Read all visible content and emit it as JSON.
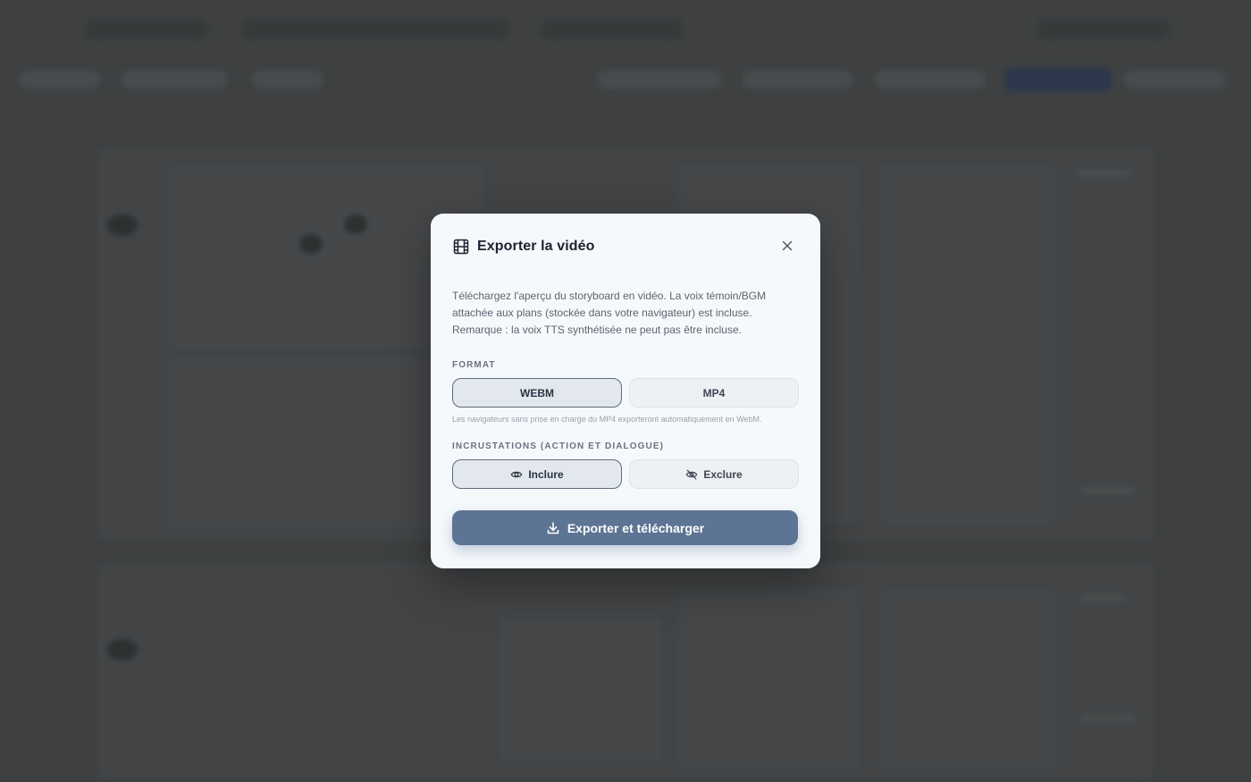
{
  "modal": {
    "title": "Exporter la vidéo",
    "description": "Téléchargez l'aperçu du storyboard en vidéo. La voix témoin/BGM attachée aux plans (stockée dans votre navigateur) est incluse. Remarque : la voix TTS synthétisée ne peut pas être incluse.",
    "format": {
      "label": "FORMAT",
      "options": [
        "WEBM",
        "MP4"
      ],
      "selected": "WEBM",
      "hint": "Les navigateurs sans prise en charge du MP4 exporteront automatiquement en WebM."
    },
    "overlays": {
      "label": "INCRUSTATIONS (ACTION ET DIALOGUE)",
      "include_label": "Inclure",
      "exclude_label": "Exclure",
      "selected": "Inclure"
    },
    "export_button": "Exporter et télécharger",
    "icons": {
      "header": "film-icon",
      "close": "close-icon",
      "include": "eye-icon",
      "exclude": "eye-off-icon",
      "export": "download-icon"
    }
  },
  "colors": {
    "accent": "#5d7494",
    "modal_bg": "#f5f9fc",
    "backdrop": "#4a4c4e"
  }
}
